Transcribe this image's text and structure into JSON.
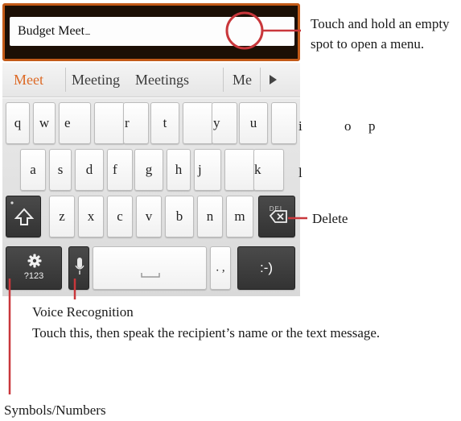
{
  "text_field": {
    "value": "Budget Meet"
  },
  "suggestions": [
    "Meet",
    "Meeting",
    "Meetings",
    "Me"
  ],
  "keyboard": {
    "row1": [
      "q",
      "w",
      "e",
      "r",
      "t",
      "y",
      "u",
      "i",
      "o",
      "p"
    ],
    "row2": [
      "a",
      "s",
      "d",
      "f",
      "g",
      "h",
      "j",
      "k",
      "l"
    ],
    "row3": [
      "z",
      "x",
      "c",
      "v",
      "b",
      "n",
      "m"
    ],
    "delete_label": "DEL",
    "symbols_label": "?123",
    "punctuation_label": ". ,",
    "smiley_label": ":-)"
  },
  "annotations": {
    "touch_hold": "Touch and hold an empty spot to open a menu.",
    "delete": "Delete",
    "voice_title": "Voice Recognition",
    "voice_desc": "Touch this, then speak the recipient’s name or the text message.",
    "symbols": "Symbols/Numbers"
  },
  "colors": {
    "accent": "#dd6a26",
    "callout": "#c9373b",
    "header_border": "#c35a18",
    "dark_key": "#3c3c3c"
  },
  "icons": {
    "shift": "shift-arrow-icon",
    "delete": "backspace-icon",
    "settings": "gear-icon",
    "voice": "microphone-icon",
    "suggestion_more": "right-triangle-icon"
  }
}
